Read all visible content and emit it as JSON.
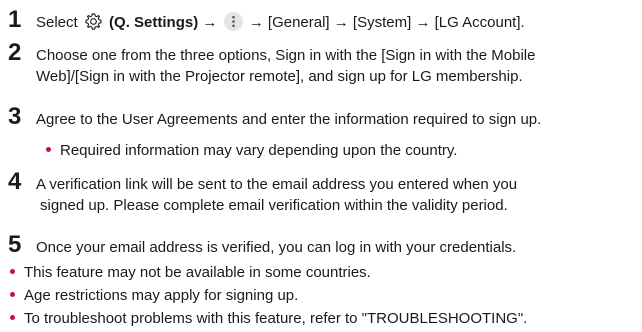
{
  "steps": [
    {
      "number": "1",
      "pre": "Select",
      "settings_label": "(Q. Settings)",
      "arrow1": "→",
      "arrow2": "→ [General] → [System] → [LG Account]."
    },
    {
      "number": "2",
      "line1": "Choose one from the three options, Sign in with the [Sign in with the Mobile",
      "line2": "Web]/[Sign in with the Projector remote], and sign up for LG membership."
    },
    {
      "number": "3",
      "line1": "Agree to the User Agreements and enter the information required to sign up.",
      "sub": "Required information may vary depending upon the country."
    },
    {
      "number": "4",
      "line1": "A verification link will be sent to the email address you entered when you",
      "line2": "signed up. Please complete email verification within the validity period."
    },
    {
      "number": "5",
      "line1": "Once your email address is verified, you can log in with your credentials."
    }
  ],
  "notes": [
    "This feature may not be available in some countries.",
    "Age restrictions may apply for signing up.",
    "To troubleshoot problems with this feature, refer to \"TROUBLESHOOTING\"."
  ],
  "colors": {
    "bullet": "#c4143c",
    "text": "#1a1a1a"
  },
  "icons": {
    "settings": "gear-icon",
    "more": "more-vertical-icon"
  }
}
